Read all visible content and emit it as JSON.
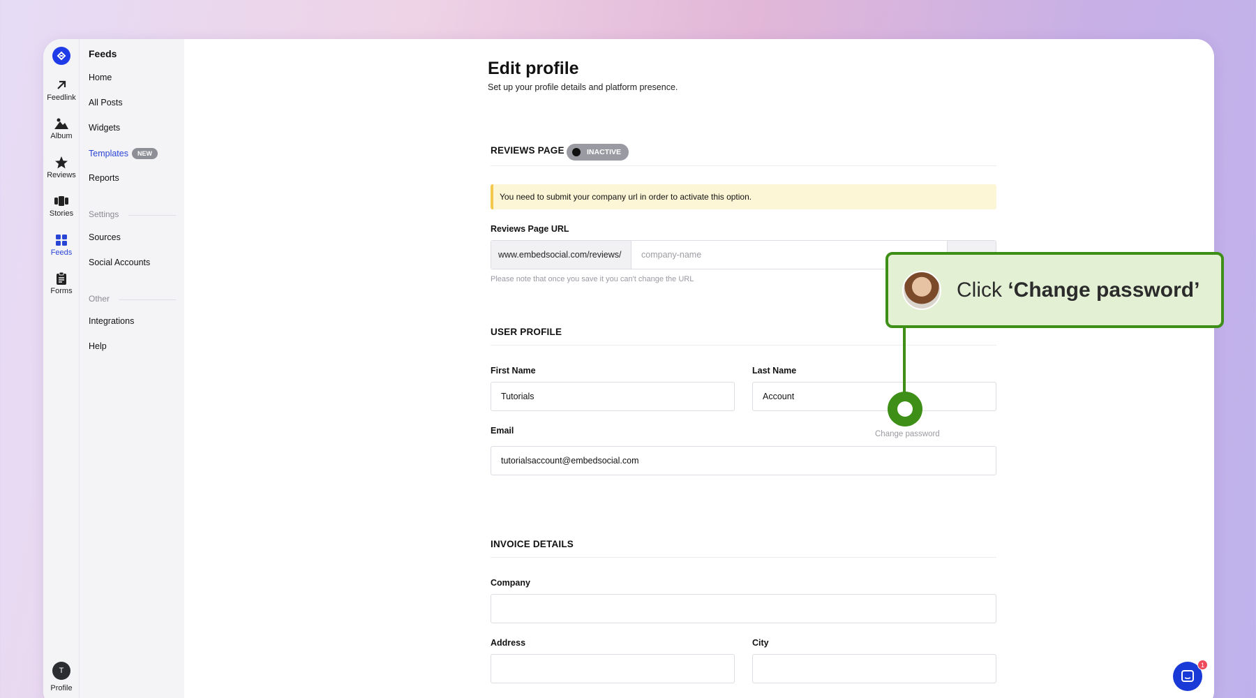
{
  "rail": {
    "items": [
      {
        "label": "Feedlink",
        "icon": "arrow-up-right-icon"
      },
      {
        "label": "Album",
        "icon": "mountain-icon"
      },
      {
        "label": "Reviews",
        "icon": "star-icon"
      },
      {
        "label": "Stories",
        "icon": "stories-icon"
      },
      {
        "label": "Feeds",
        "icon": "grid-icon",
        "active": true
      },
      {
        "label": "Forms",
        "icon": "clipboard-icon"
      }
    ],
    "profile_initial": "T",
    "profile_label": "Profile"
  },
  "menu": {
    "title": "Feeds",
    "items": [
      "Home",
      "All Posts",
      "Widgets",
      "Templates",
      "Reports"
    ],
    "templates_badge": "NEW",
    "settings_title": "Settings",
    "settings_items": [
      "Sources",
      "Social Accounts"
    ],
    "other_title": "Other",
    "other_items": [
      "Integrations",
      "Help"
    ]
  },
  "page": {
    "title": "Edit profile",
    "subtitle": "Set up your profile details and platform presence."
  },
  "reviews_page": {
    "heading": "REVIEWS PAGE",
    "status": "INACTIVE",
    "alert": "You need to submit your company url in order to activate this option.",
    "url_label": "Reviews Page URL",
    "url_prefix": "www.embedsocial.com/reviews/",
    "url_placeholder": "company-name",
    "hint": "Please note that once you save it you can't change the URL"
  },
  "user_profile": {
    "heading": "USER PROFILE",
    "first_name_label": "First Name",
    "first_name": "Tutorials",
    "last_name_label": "Last Name",
    "last_name": "Account",
    "email_label": "Email",
    "change_password": "Change password",
    "email": "tutorialsaccount@embedsocial.com"
  },
  "invoice": {
    "heading": "INVOICE DETAILS",
    "company_label": "Company",
    "address_label": "Address",
    "city_label": "City"
  },
  "tutorial": {
    "prefix": "Click ",
    "target": "‘Change password’"
  },
  "chat": {
    "badge": "1"
  },
  "colors": {
    "accent": "#2a45d6",
    "tutorial_green": "#3d8f17",
    "alert_bg": "#fdf6d6"
  }
}
